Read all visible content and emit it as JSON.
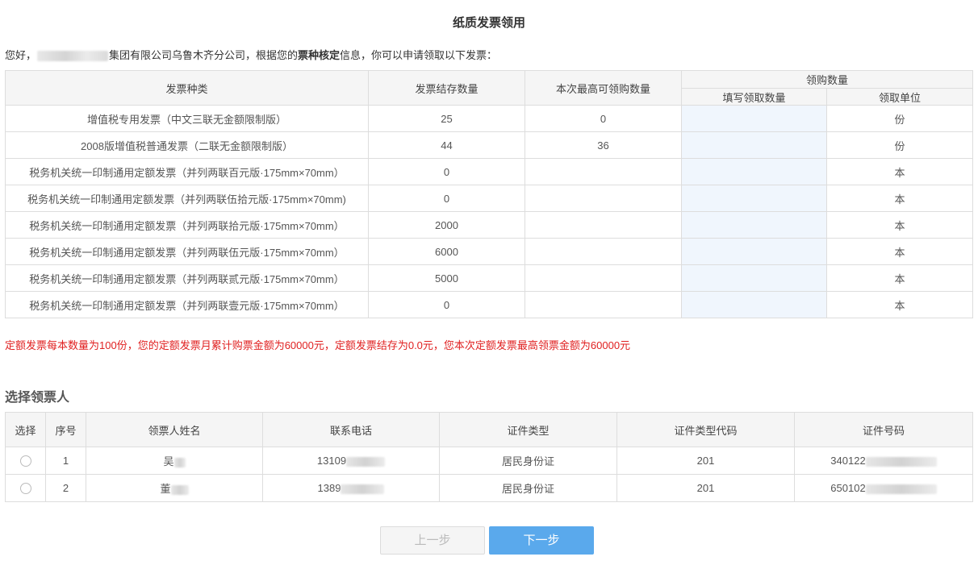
{
  "page": {
    "title": "纸质发票领用"
  },
  "greeting": {
    "prefix": "您好，",
    "company": "集团有限公司乌鲁木齐分公司，根据您的",
    "highlight": "票种核定",
    "suffix": "信息，你可以申请领取以下发票："
  },
  "invoice_table": {
    "headers": {
      "type": "发票种类",
      "stock": "发票结存数量",
      "max": "本次最高可领购数量",
      "group": "领购数量",
      "fill": "填写领取数量",
      "unit": "领取单位"
    },
    "rows": [
      {
        "type": "增值税专用发票（中文三联无金额限制版）",
        "stock": "25",
        "max": "0",
        "unit": "份"
      },
      {
        "type": "2008版增值税普通发票（二联无金额限制版）",
        "stock": "44",
        "max": "36",
        "unit": "份"
      },
      {
        "type": "税务机关统一印制通用定额发票（并列两联百元版·175mm×70mm）",
        "stock": "0",
        "max": "",
        "unit": "本"
      },
      {
        "type": "税务机关统一印制通用定额发票（并列两联伍拾元版·175mm×70mm)",
        "stock": "0",
        "max": "",
        "unit": "本"
      },
      {
        "type": "税务机关统一印制通用定额发票（并列两联拾元版·175mm×70mm）",
        "stock": "2000",
        "max": "",
        "unit": "本"
      },
      {
        "type": "税务机关统一印制通用定额发票（并列两联伍元版·175mm×70mm）",
        "stock": "6000",
        "max": "",
        "unit": "本"
      },
      {
        "type": "税务机关统一印制通用定额发票（并列两联贰元版·175mm×70mm）",
        "stock": "5000",
        "max": "",
        "unit": "本"
      },
      {
        "type": "税务机关统一印制通用定额发票（并列两联壹元版·175mm×70mm）",
        "stock": "0",
        "max": "",
        "unit": "本"
      }
    ]
  },
  "notice": "定额发票每本数量为100份，您的定额发票月累计购票金额为60000元，定额发票结存为0.0元，您本次定额发票最高领票金额为60000元",
  "recipients": {
    "title": "选择领票人",
    "headers": {
      "select": "选择",
      "index": "序号",
      "name": "领票人姓名",
      "phone": "联系电话",
      "id_type": "证件类型",
      "id_type_code": "证件类型代码",
      "id_number": "证件号码"
    },
    "rows": [
      {
        "index": "1",
        "name": "吴",
        "phone": "13109",
        "id_type": "居民身份证",
        "id_type_code": "201",
        "id_number": "340122"
      },
      {
        "index": "2",
        "name": "董",
        "phone": "1389",
        "id_type": "居民身份证",
        "id_type_code": "201",
        "id_number": "650102"
      }
    ]
  },
  "buttons": {
    "prev": "上一步",
    "next": "下一步"
  },
  "colors": {
    "primary": "#5aa9ec",
    "notice": "#e02020",
    "input_bg": "#f0f6fd"
  }
}
